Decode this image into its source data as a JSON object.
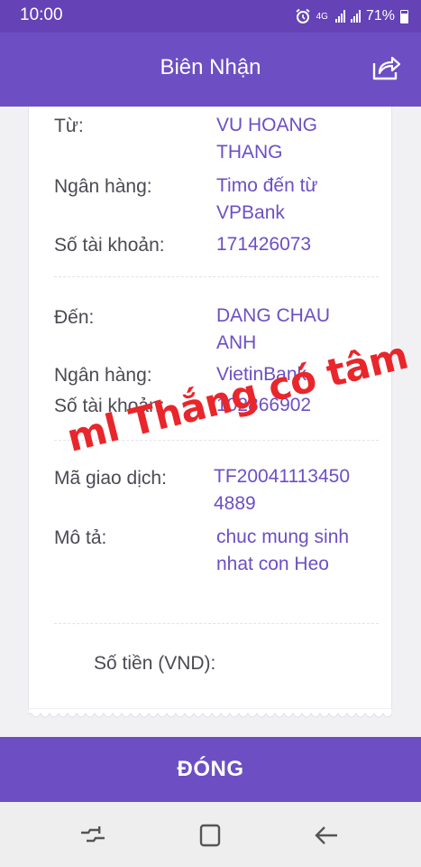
{
  "status_bar": {
    "time": "10:00",
    "network": "4G",
    "battery": "71%"
  },
  "header": {
    "title": "Biên Nhận",
    "share_icon": "share-icon"
  },
  "sender": {
    "label": "Từ:",
    "name": "VU HOANG THANG",
    "bank_label": "Ngân hàng:",
    "bank": "Timo đến từ VPBank",
    "account_label": "Số tài khoản:",
    "account": "171426073"
  },
  "receiver": {
    "label": "Đến:",
    "name": "DANG CHAU ANH",
    "bank_label": "Ngân hàng:",
    "bank": "VietinBank",
    "account_label": "Số tài khoản:",
    "account": "102866902"
  },
  "transaction": {
    "id_label": "Mã giao dịch:",
    "id": "TF20041113450 4889",
    "desc_label": "Mô tả:",
    "desc": "chuc mung sinh nhat con Heo"
  },
  "amount": {
    "label": "Số tiền (VND):"
  },
  "overlay_text": "ml Thắng có tâm",
  "close_button": "ĐÓNG",
  "nav": {
    "recent_icon": "recent-apps-icon",
    "home_icon": "home-icon",
    "back_icon": "back-icon"
  },
  "colors": {
    "primary": "#6d4fc3",
    "status_bar": "#6542b5",
    "value_text": "#6d4fc3",
    "stamp": "#e8262b"
  }
}
